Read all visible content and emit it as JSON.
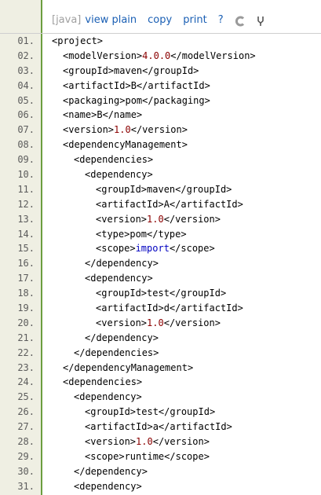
{
  "toolbar": {
    "lang": "[java]",
    "view_plain": "view plain",
    "copy": "copy",
    "print": "print",
    "help": "?",
    "icon1": "copy-to-clipboard-icon",
    "icon2": "fork-icon"
  },
  "lines": [
    {
      "n": "01.",
      "indent": 0,
      "parts": [
        [
          "t",
          "<project>"
        ]
      ]
    },
    {
      "n": "02.",
      "indent": 1,
      "parts": [
        [
          "t",
          "<modelVersion>"
        ],
        [
          "num",
          "4.0.0"
        ],
        [
          "t",
          "</modelVersion>"
        ]
      ]
    },
    {
      "n": "03.",
      "indent": 1,
      "parts": [
        [
          "t",
          "<groupId>maven</groupId>"
        ]
      ]
    },
    {
      "n": "04.",
      "indent": 1,
      "parts": [
        [
          "t",
          "<artifactId>B</artifactId>"
        ]
      ]
    },
    {
      "n": "05.",
      "indent": 1,
      "parts": [
        [
          "t",
          "<packaging>pom</packaging>"
        ]
      ]
    },
    {
      "n": "06.",
      "indent": 1,
      "parts": [
        [
          "t",
          "<name>B</name>"
        ]
      ]
    },
    {
      "n": "07.",
      "indent": 1,
      "parts": [
        [
          "t",
          "<version>"
        ],
        [
          "num",
          "1.0"
        ],
        [
          "t",
          "</version>"
        ]
      ]
    },
    {
      "n": "08.",
      "indent": 1,
      "parts": [
        [
          "t",
          "<dependencyManagement>"
        ]
      ]
    },
    {
      "n": "09.",
      "indent": 2,
      "parts": [
        [
          "t",
          "<dependencies>"
        ]
      ]
    },
    {
      "n": "10.",
      "indent": 3,
      "parts": [
        [
          "t",
          "<dependency>"
        ]
      ]
    },
    {
      "n": "11.",
      "indent": 4,
      "parts": [
        [
          "t",
          "<groupId>maven</groupId>"
        ]
      ]
    },
    {
      "n": "12.",
      "indent": 4,
      "parts": [
        [
          "t",
          "<artifactId>A</artifactId>"
        ]
      ]
    },
    {
      "n": "13.",
      "indent": 4,
      "parts": [
        [
          "t",
          "<version>"
        ],
        [
          "num",
          "1.0"
        ],
        [
          "t",
          "</version>"
        ]
      ]
    },
    {
      "n": "14.",
      "indent": 4,
      "parts": [
        [
          "t",
          "<type>pom</type>"
        ]
      ]
    },
    {
      "n": "15.",
      "indent": 4,
      "parts": [
        [
          "t",
          "<scope>"
        ],
        [
          "kw",
          "import"
        ],
        [
          "t",
          "</scope>"
        ]
      ]
    },
    {
      "n": "16.",
      "indent": 3,
      "parts": [
        [
          "t",
          "</dependency>"
        ]
      ]
    },
    {
      "n": "17.",
      "indent": 3,
      "parts": [
        [
          "t",
          "<dependency>"
        ]
      ]
    },
    {
      "n": "18.",
      "indent": 4,
      "parts": [
        [
          "t",
          "<groupId>test</groupId>"
        ]
      ]
    },
    {
      "n": "19.",
      "indent": 4,
      "parts": [
        [
          "t",
          "<artifactId>d</artifactId>"
        ]
      ]
    },
    {
      "n": "20.",
      "indent": 4,
      "parts": [
        [
          "t",
          "<version>"
        ],
        [
          "num",
          "1.0"
        ],
        [
          "t",
          "</version>"
        ]
      ]
    },
    {
      "n": "21.",
      "indent": 3,
      "parts": [
        [
          "t",
          "</dependency>"
        ]
      ]
    },
    {
      "n": "22.",
      "indent": 2,
      "parts": [
        [
          "t",
          "</dependencies>"
        ]
      ]
    },
    {
      "n": "23.",
      "indent": 1,
      "parts": [
        [
          "t",
          "</dependencyManagement>"
        ]
      ]
    },
    {
      "n": "24.",
      "indent": 1,
      "parts": [
        [
          "t",
          "<dependencies>"
        ]
      ]
    },
    {
      "n": "25.",
      "indent": 2,
      "parts": [
        [
          "t",
          "<dependency>"
        ]
      ]
    },
    {
      "n": "26.",
      "indent": 3,
      "parts": [
        [
          "t",
          "<groupId>test</groupId>"
        ]
      ]
    },
    {
      "n": "27.",
      "indent": 3,
      "parts": [
        [
          "t",
          "<artifactId>a</artifactId>"
        ]
      ]
    },
    {
      "n": "28.",
      "indent": 3,
      "parts": [
        [
          "t",
          "<version>"
        ],
        [
          "num",
          "1.0"
        ],
        [
          "t",
          "</version>"
        ]
      ]
    },
    {
      "n": "29.",
      "indent": 3,
      "parts": [
        [
          "t",
          "<scope>runtime</scope>"
        ]
      ]
    },
    {
      "n": "30.",
      "indent": 2,
      "parts": [
        [
          "t",
          "</dependency>"
        ]
      ]
    },
    {
      "n": "31.",
      "indent": 2,
      "parts": [
        [
          "t",
          "<dependency>"
        ]
      ]
    }
  ]
}
